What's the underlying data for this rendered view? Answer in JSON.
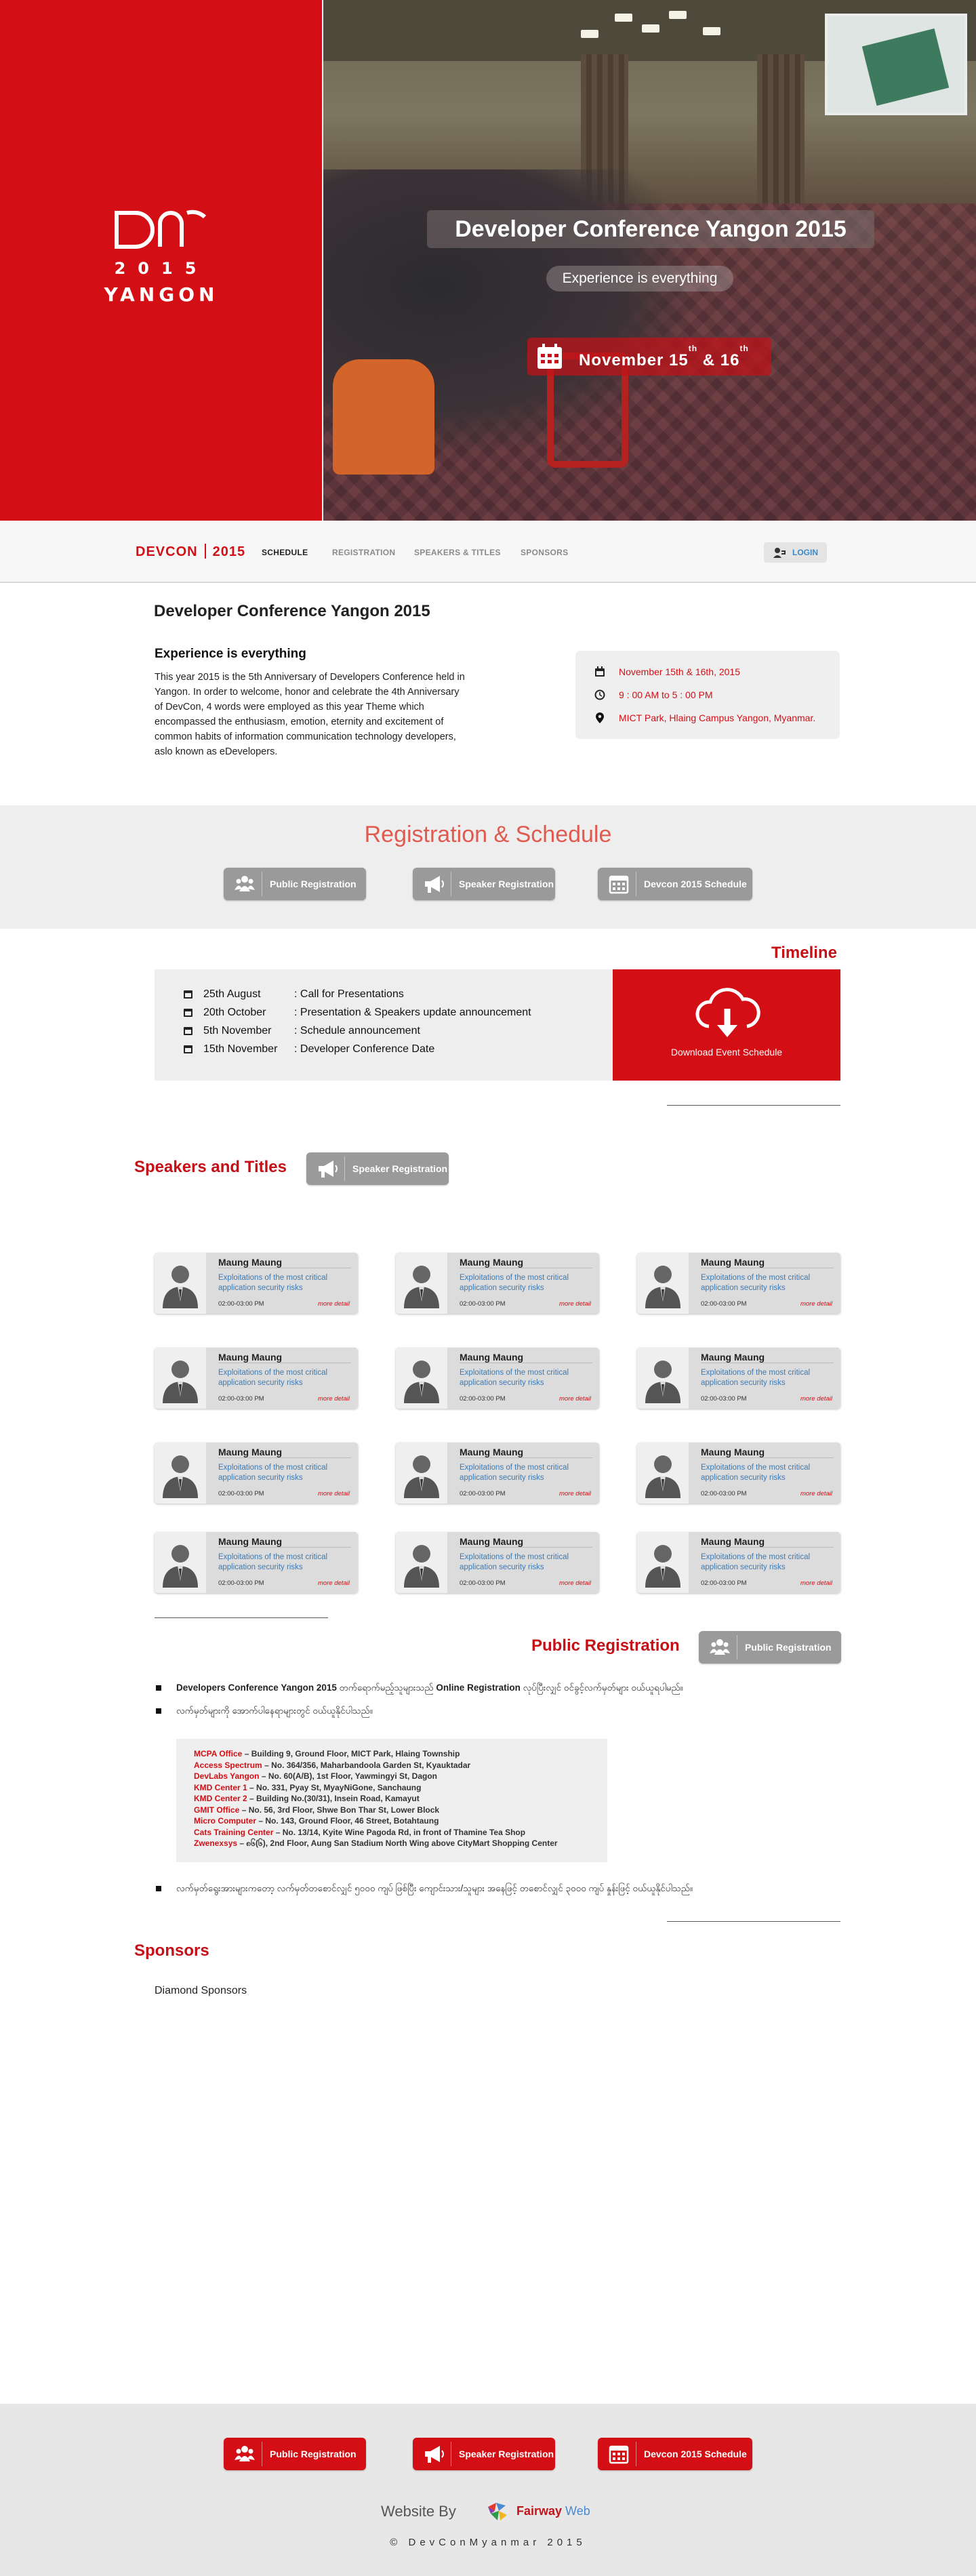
{
  "hero": {
    "logo_year": "2015",
    "logo_city": "YANGON",
    "title": "Developer Conference Yangon 2015",
    "subtitle": "Experience is everything",
    "date_prefix": "November 15",
    "date_sup1": "th",
    "date_mid": " & 16",
    "date_sup2": "th"
  },
  "nav": {
    "brand_left": "DEVCON",
    "brand_right": "2015",
    "items": [
      "SCHEDULE",
      "REGISTRATION",
      "SPEAKERS & TITLES",
      "SPONSORS"
    ],
    "login": "LOGIN"
  },
  "about": {
    "title": "Developer Conference Yangon 2015",
    "heading": "Experience is everything",
    "body": "This year 2015 is the 5th Anniversary of Developers Conference held in Yangon. In order to welcome, honor and celebrate the 4th Anniversary of DevCon, 4 words were employed as this year Theme which encompassed the enthusiasm, emotion, eternity and excitement of common habits of information communication technology developers, aslo known as eDevelopers.",
    "info": {
      "date": "November 15th & 16th, 2015",
      "time": "9 : 00 AM to 5 : 00 PM",
      "place": "MICT Park, Hlaing Campus Yangon, Myanmar."
    }
  },
  "registration": {
    "title": "Registration & Schedule",
    "public": "Public Registration",
    "speaker": "Speaker Registration",
    "schedule": "Devcon 2015 Schedule"
  },
  "timeline": {
    "title": "Timeline",
    "rows": [
      {
        "date": "25th  August",
        "text": ":  Call for Presentations"
      },
      {
        "date": "20th October",
        "text": ":  Presentation & Speakers update announcement"
      },
      {
        "date": "5th  November",
        "text": ":  Schedule announcement"
      },
      {
        "date": "15th November",
        "text": ":  Developer Conference Date"
      }
    ],
    "download": "Download Event Schedule"
  },
  "speakers": {
    "title": "Speakers and Titles",
    "button": "Speaker Registration",
    "card": {
      "name": "Maung Maung",
      "role": "Exploitations of the most critical application security risks",
      "time": "02:00-03:00 PM",
      "more": "more detail"
    }
  },
  "public_reg": {
    "title": "Public Registration",
    "button": "Public Registration",
    "bullet1_bold": "Developers Conference Yangon 2015",
    "bullet1_mid": " တက်ရောက်မည့်သူများသည် ",
    "bullet1_bold2": "Online Registration",
    "bullet1_end": " လုပ်ပြီးလျှင် ဝင်ခွင့်လက်မှတ်များ ဝယ်ယူရပါမည်။",
    "bullet2": "လက်မှတ်များကို အောက်ပါနေရာများတွင် ဝယ်ယူနိုင်ပါသည်။",
    "addresses": [
      {
        "name": "MCPA Office",
        "addr": "– Building 9, Ground Floor, MICT Park, Hlaing Township"
      },
      {
        "name": "Access Spectrum",
        "addr": "– No. 364/356, Maharbandoola Garden St, Kyauktadar"
      },
      {
        "name": "DevLabs Yangon",
        "addr": "– No. 60(A/B), 1st Floor, Yawmingyi St, Dagon"
      },
      {
        "name": "KMD Center 1",
        "addr": "– No. 331, Pyay St, MyayNiGone, Sanchaung"
      },
      {
        "name": "KMD Center 2",
        "addr": "– Building No.(30/31), Insein Road, Kamayut"
      },
      {
        "name": "GMIT Office",
        "addr": "– No. 56, 3rd Floor, Shwe Bon Thar St, Lower Block"
      },
      {
        "name": "Micro Computer",
        "addr": "– No. 143, Ground Floor, 46 Street, Botahtaung"
      },
      {
        "name": "Cats Training Center",
        "addr": "– No. 13/14, Kyite Wine Pagoda Rd, in front of Thamine Tea Shop"
      },
      {
        "name": "Zwenexsys",
        "addr": "– ၈၆(၆), 2nd Floor, Aung San Stadium North Wing above CityMart Shopping Center"
      }
    ],
    "bullet3": "လက်မှတ်ရွေးအားများကတော့ လက်မှတ်တစောင်လျှင် ၅၀၀၀ ကျပ် ဖြစ်ပြီး ကျောင်းသား/သူများ အနေဖြင့် တစောင်လျှင် ၃၀၀၀ ကျပ် နှုန်းဖြင့် ဝယ်ယူနိုင်ပါသည်။"
  },
  "sponsors": {
    "title": "Sponsors",
    "sub": "Diamond Sponsors"
  },
  "footer": {
    "public": "Public Registration",
    "speaker": "Speaker Registration",
    "schedule": "Devcon 2015 Schedule",
    "website_by": "Website By",
    "fairway": "Fairway",
    "web": " Web",
    "copyright": "© DevConMyanmar 2015"
  },
  "colors": {
    "brand_red": "#d30f15",
    "gray_button": "#9a9a9a",
    "link_blue": "#3a7bb6"
  },
  "icons": [
    "calendar-icon",
    "clock-icon",
    "map-pin-icon",
    "people-icon",
    "megaphone-icon",
    "cloud-download-icon",
    "user-icon",
    "login-icon"
  ]
}
